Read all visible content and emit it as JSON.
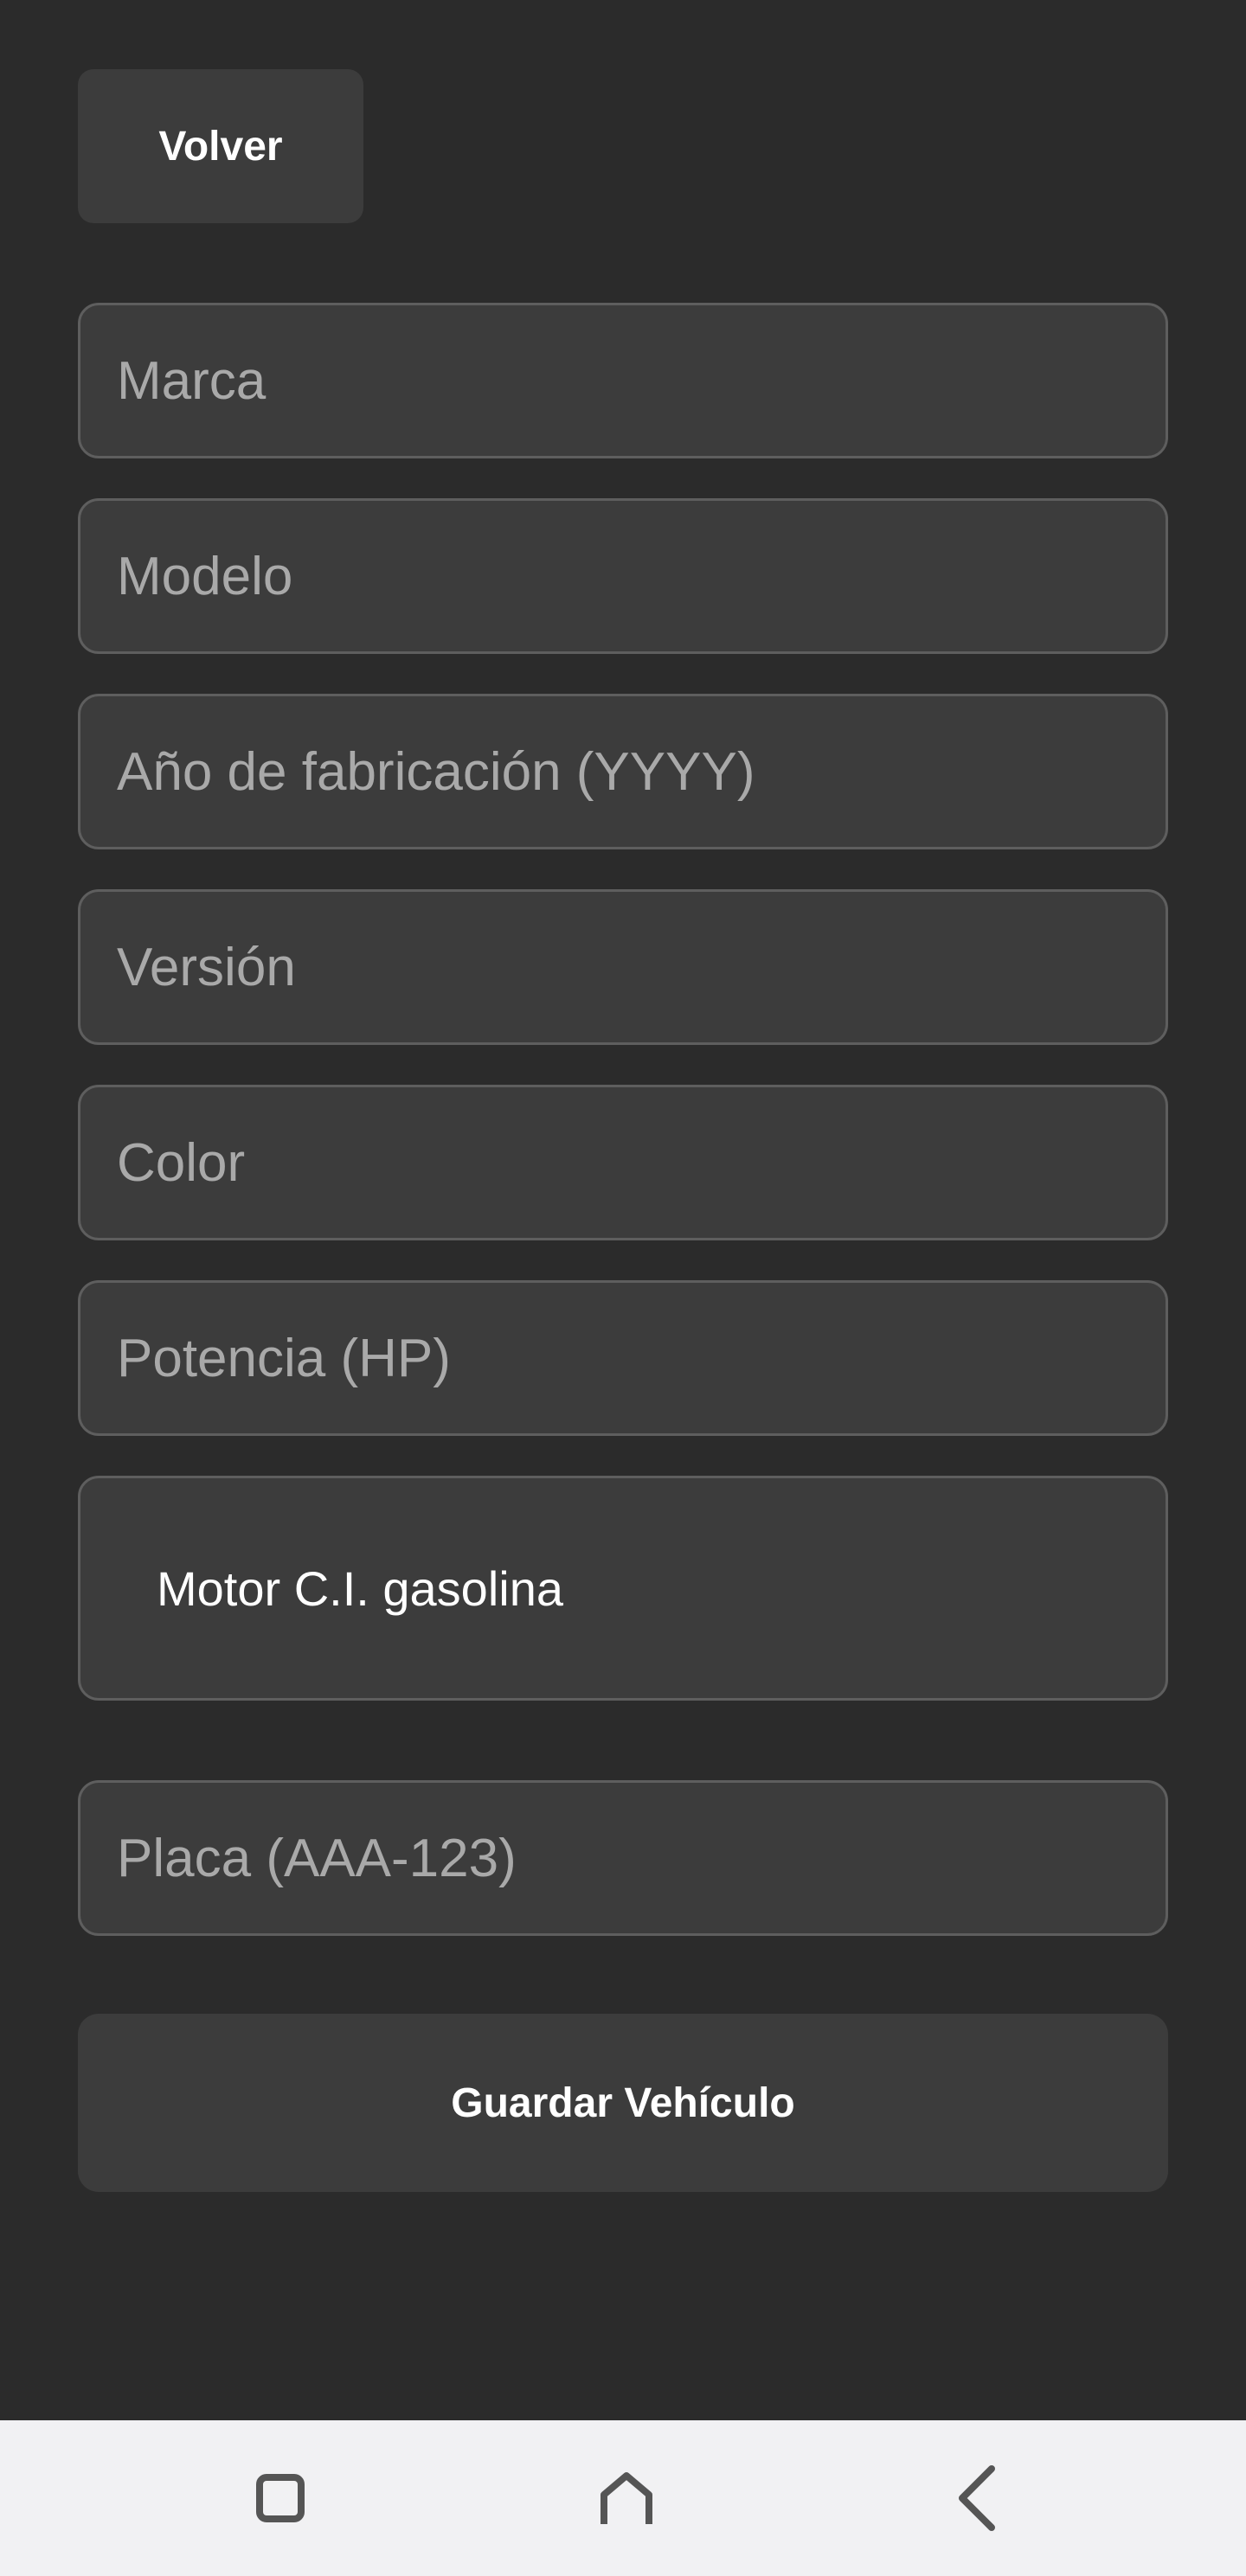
{
  "header": {
    "back_label": "Volver"
  },
  "form": {
    "marca": {
      "placeholder": "Marca",
      "value": ""
    },
    "modelo": {
      "placeholder": "Modelo",
      "value": ""
    },
    "anio": {
      "placeholder": "Año de fabricación (YYYY)",
      "value": ""
    },
    "version": {
      "placeholder": "Versión",
      "value": ""
    },
    "color": {
      "placeholder": "Color",
      "value": ""
    },
    "potencia": {
      "placeholder": "Potencia (HP)",
      "value": ""
    },
    "motor": {
      "selected": "Motor C.I. gasolina"
    },
    "placa": {
      "placeholder": "Placa (AAA-123)",
      "value": ""
    },
    "save_label": "Guardar Vehículo"
  },
  "colors": {
    "background": "#2b2b2b",
    "field_bg": "#3c3c3c",
    "field_border": "#5e5e5e",
    "placeholder": "#a9a9a9",
    "nav_bar": "#f1f1f3",
    "nav_icon": "#555555"
  },
  "nav": {
    "icons": [
      "recent-apps-icon",
      "home-icon",
      "back-icon"
    ]
  }
}
